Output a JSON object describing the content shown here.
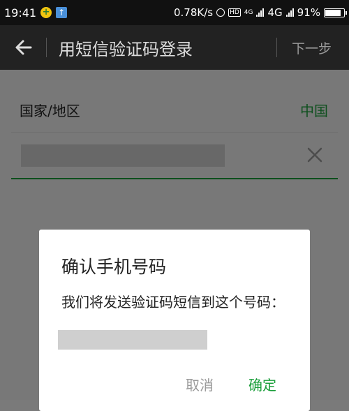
{
  "status_bar": {
    "time": "19:41",
    "network_speed": "0.78K/s",
    "network_type": "4G",
    "small_4g": "4G",
    "battery_percent": "91%",
    "battery_level": 0.91,
    "hd_label": "HD"
  },
  "title_bar": {
    "title": "用短信验证码登录",
    "next_label": "下一步"
  },
  "form": {
    "country_label": "国家/地区",
    "country_value": "中国"
  },
  "dialog": {
    "title": "确认手机号码",
    "message": "我们将发送验证码短信到这个号码：",
    "cancel_label": "取消",
    "confirm_label": "确定"
  },
  "colors": {
    "accent": "#1a9e3a",
    "title_bar_bg": "#222222"
  }
}
